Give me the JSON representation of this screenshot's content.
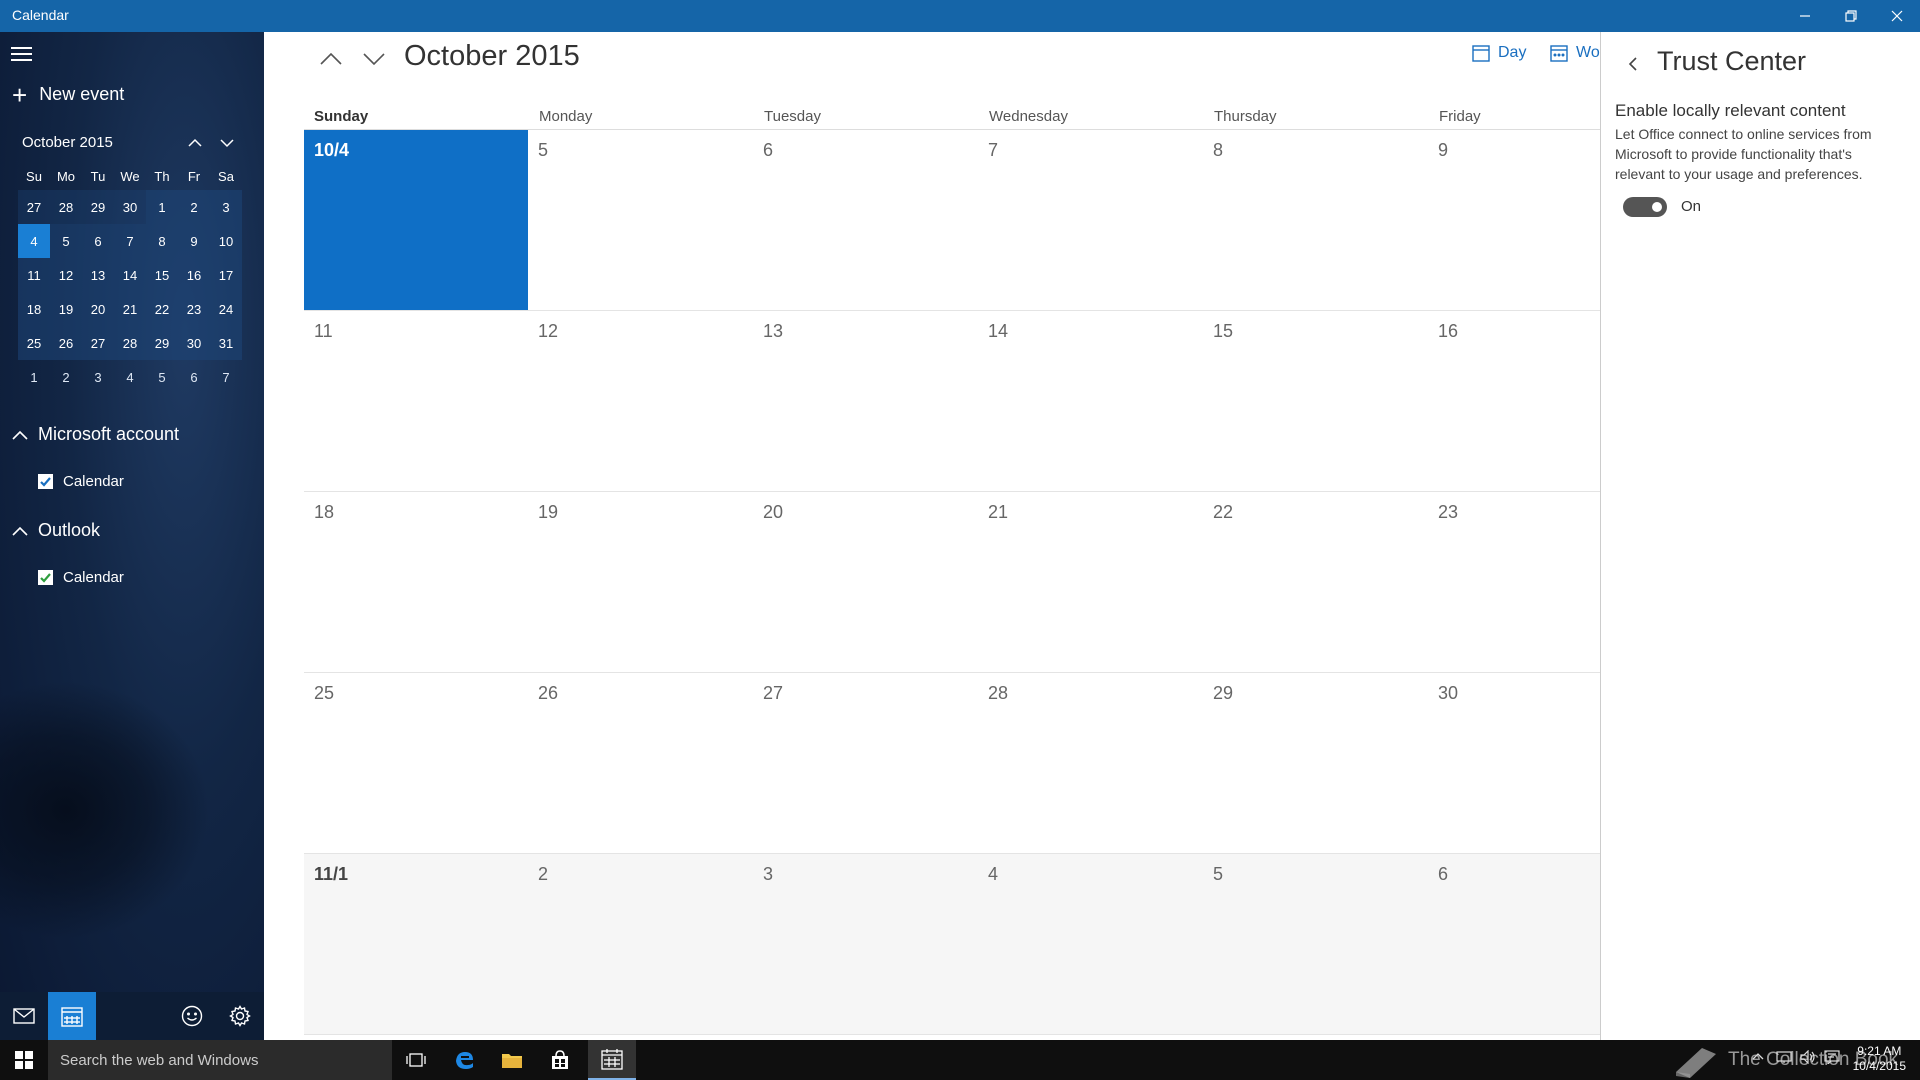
{
  "window": {
    "title": "Calendar"
  },
  "sidebar": {
    "new_event_label": "New event",
    "mini_calendar": {
      "month_label": "October 2015",
      "weekdays": [
        "Su",
        "Mo",
        "Tu",
        "We",
        "Th",
        "Fr",
        "Sa"
      ],
      "weeks": [
        [
          "27",
          "28",
          "29",
          "30",
          "1",
          "2",
          "3"
        ],
        [
          "4",
          "5",
          "6",
          "7",
          "8",
          "9",
          "10"
        ],
        [
          "11",
          "12",
          "13",
          "14",
          "15",
          "16",
          "17"
        ],
        [
          "18",
          "19",
          "20",
          "21",
          "22",
          "23",
          "24"
        ],
        [
          "25",
          "26",
          "27",
          "28",
          "29",
          "30",
          "31"
        ],
        [
          "1",
          "2",
          "3",
          "4",
          "5",
          "6",
          "7"
        ]
      ],
      "selected": "4"
    },
    "accounts": [
      {
        "name": "Microsoft account",
        "calendar": "Calendar",
        "check_color": "#1a6fc0"
      },
      {
        "name": "Outlook",
        "calendar": "Calendar",
        "check_color": "#2e9e3e"
      }
    ]
  },
  "main": {
    "month_title": "October 2015",
    "views": [
      {
        "label": "Day",
        "icon": "day-view-icon"
      },
      {
        "label": "Wor",
        "icon": "work-week-icon"
      }
    ],
    "weekday_headers": [
      "Sunday",
      "Monday",
      "Tuesday",
      "Wednesday",
      "Thursday",
      "Friday"
    ],
    "weeks": [
      [
        "10/4",
        "5",
        "6",
        "7",
        "8",
        "9"
      ],
      [
        "11",
        "12",
        "13",
        "14",
        "15",
        "16"
      ],
      [
        "18",
        "19",
        "20",
        "21",
        "22",
        "23"
      ],
      [
        "25",
        "26",
        "27",
        "28",
        "29",
        "30"
      ],
      [
        "11/1",
        "2",
        "3",
        "4",
        "5",
        "6"
      ]
    ],
    "today": "10/4"
  },
  "trust_center": {
    "title": "Trust Center",
    "setting_title": "Enable locally relevant content",
    "setting_description": "Let Office connect to online services from Microsoft to provide functionality that's relevant to your usage and preferences.",
    "toggle_state": "On"
  },
  "taskbar": {
    "search_placeholder": "Search the web and Windows",
    "watermark": "The Collection Book",
    "time": "9:21 AM",
    "date": "10/4/2015"
  },
  "colors": {
    "accent": "#0f6fc6",
    "titlebar": "#1565a8",
    "sidebar": "#122645"
  }
}
